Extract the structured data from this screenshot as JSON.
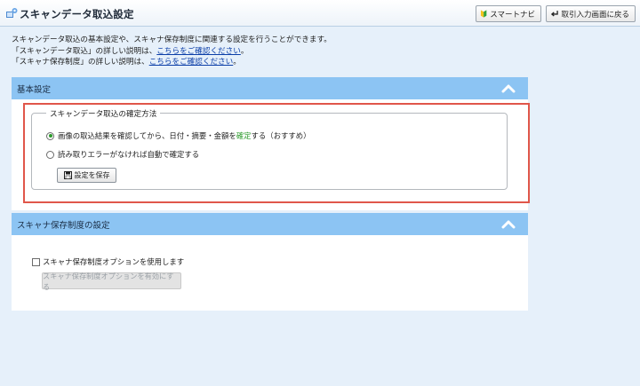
{
  "header": {
    "title": "スキャンデータ取込設定",
    "smart_navi_label": "スマートナビ",
    "back_label": "取引入力画面に戻る"
  },
  "intro": {
    "line1": "スキャンデータ取込の基本設定や、スキャナ保存制度に関連する設定を行うことができます。",
    "line2_prefix": "「スキャンデータ取込」の詳しい説明は、",
    "line2_link": "こちらをご確認ください",
    "line3_prefix": "「スキャナ保存制度」の詳しい説明は、",
    "line3_link": "こちらをご確認ください",
    "line_suffix": "。"
  },
  "basic_settings": {
    "title": "基本設定",
    "legend": "スキャンデータ取込の確定方法",
    "option1_pre": "画像の取込結果を確認してから、日付・摘要・金額を",
    "option1_green": "確定",
    "option1_post": "する（おすすめ）",
    "option1_checked": true,
    "option2": "読み取りエラーがなければ自動で確定する",
    "option2_checked": false,
    "save_label": "設定を保存"
  },
  "scanner_settings": {
    "title": "スキャナ保存制度の設定",
    "checkbox_label": "スキャナ保存制度オプションを使用します",
    "checkbox_checked": false,
    "enable_button_label": "スキャナ保存制度オプションを有効にする"
  },
  "colors": {
    "section_header": "#8cc4f3",
    "background": "#e6f0fa",
    "highlight_frame": "#e0564a",
    "accent_green": "#2a9a2a",
    "link": "#0b3ea8"
  }
}
